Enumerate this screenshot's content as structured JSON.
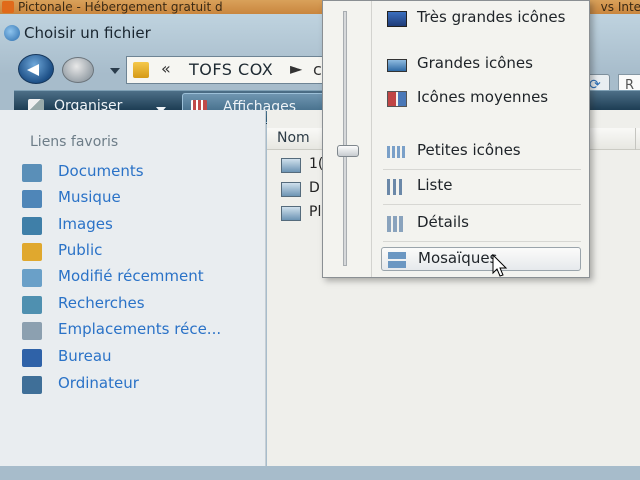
{
  "browser": {
    "title": "Pictonale - Hébergement gratuit d",
    "title_right": "vs Inter"
  },
  "dialog": {
    "title": "Choisir un fichier"
  },
  "address": {
    "separator": "«",
    "crumb": "TOFS COX",
    "arrow": "►",
    "tail": "c"
  },
  "search": {
    "placeholder": "R"
  },
  "toolbar": {
    "organize_label": "Organiser",
    "views_label": "Affichages"
  },
  "favorites": {
    "title": "Liens favoris",
    "items": [
      {
        "label": "Documents",
        "icon": "documents-icon",
        "color": "#5a8fb8"
      },
      {
        "label": "Musique",
        "icon": "music-icon",
        "color": "#4f86b8"
      },
      {
        "label": "Images",
        "icon": "pictures-icon",
        "color": "#3f7fa8"
      },
      {
        "label": "Public",
        "icon": "public-folder-icon",
        "color": "#e0a82e"
      },
      {
        "label": "Modifié récemment",
        "icon": "recent-icon",
        "color": "#6aa0c8"
      },
      {
        "label": "Recherches",
        "icon": "searches-icon",
        "color": "#4f90b0"
      },
      {
        "label": "Emplacements réce...",
        "icon": "recent-places-icon",
        "color": "#8ca0b0"
      },
      {
        "label": "Bureau",
        "icon": "desktop-icon",
        "color": "#2f62a8"
      },
      {
        "label": "Ordinateur",
        "icon": "computer-icon",
        "color": "#3f6f98"
      }
    ]
  },
  "content": {
    "column_name": "Nom",
    "files": [
      {
        "name": "1("
      },
      {
        "name": "D"
      },
      {
        "name": "Pl"
      }
    ]
  },
  "views_menu": {
    "items": [
      {
        "label": "Très grandes icônes",
        "icon": "extra-large-icons-icon"
      },
      {
        "label": "Grandes icônes",
        "icon": "large-icons-icon"
      },
      {
        "label": "Icônes moyennes",
        "icon": "medium-icons-icon"
      },
      {
        "label": "Petites icônes",
        "icon": "small-icons-icon"
      },
      {
        "label": "Liste",
        "icon": "list-view-icon"
      },
      {
        "label": "Détails",
        "icon": "details-view-icon"
      },
      {
        "label": "Mosaïques",
        "icon": "tiles-view-icon"
      }
    ],
    "hovered": "Mosaïques"
  }
}
